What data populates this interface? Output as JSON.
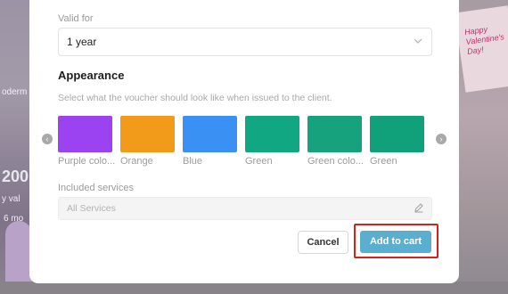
{
  "background": {
    "left_big": "200",
    "left_text_1": "oderm",
    "left_text_2": "y val",
    "left_text_3": "6 mo",
    "right_card_text": "Happy Valentine's Day!"
  },
  "validity": {
    "label": "Valid for",
    "value": "1 year"
  },
  "appearance": {
    "heading": "Appearance",
    "description": "Select what the voucher should look like when issued to the client.",
    "swatches": [
      {
        "label": "Purple colo...",
        "color": "#9b43f0"
      },
      {
        "label": "Orange",
        "color": "#f29a1a"
      },
      {
        "label": "Blue",
        "color": "#3a90f3"
      },
      {
        "label": "Green",
        "color": "#12a783"
      },
      {
        "label": "Green colo...",
        "color": "#16a27d"
      },
      {
        "label": "Green",
        "color": "#10a17b"
      }
    ]
  },
  "services": {
    "label": "Included services",
    "value": "All Services"
  },
  "actions": {
    "cancel_label": "Cancel",
    "add_label": "Add to cart"
  }
}
